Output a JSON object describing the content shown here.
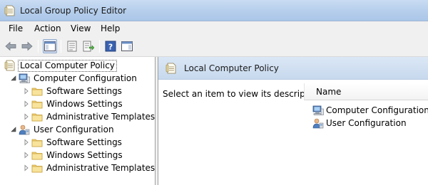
{
  "window": {
    "title": "Local Group Policy Editor",
    "icon": "gpedit-app-icon"
  },
  "menu": [
    {
      "label": "File"
    },
    {
      "label": "Action"
    },
    {
      "label": "View"
    },
    {
      "label": "Help"
    }
  ],
  "toolbar": {
    "buttons": [
      "back-arrow-icon",
      "forward-arrow-icon",
      "show-hide-tree-icon",
      "properties-icon",
      "export-list-icon",
      "help-icon",
      "show-action-pane-icon"
    ],
    "active": "show-hide-tree-icon"
  },
  "tree": {
    "root": {
      "label": "Local Computer Policy",
      "icon": "policy-document-icon",
      "selected": true
    },
    "computer": {
      "label": "Computer Configuration",
      "icon": "computer-icon",
      "children": [
        {
          "label": "Software Settings",
          "icon": "folder-icon"
        },
        {
          "label": "Windows Settings",
          "icon": "folder-icon"
        },
        {
          "label": "Administrative Templates",
          "icon": "folder-icon"
        }
      ]
    },
    "user": {
      "label": "User Configuration",
      "icon": "user-icon",
      "children": [
        {
          "label": "Software Settings",
          "icon": "folder-icon"
        },
        {
          "label": "Windows Settings",
          "icon": "folder-icon"
        },
        {
          "label": "Administrative Templates",
          "icon": "folder-icon"
        }
      ]
    }
  },
  "details": {
    "header": "Local Computer Policy",
    "description": "Select an item to view its description.",
    "column_name": "Name",
    "items": [
      {
        "label": "Computer Configuration",
        "icon": "computer-icon"
      },
      {
        "label": "User Configuration",
        "icon": "user-icon"
      }
    ]
  },
  "colors": {
    "title_bar": "#b7cfec",
    "header_band": "#c7d9ee",
    "folder": "#f5d77a"
  }
}
